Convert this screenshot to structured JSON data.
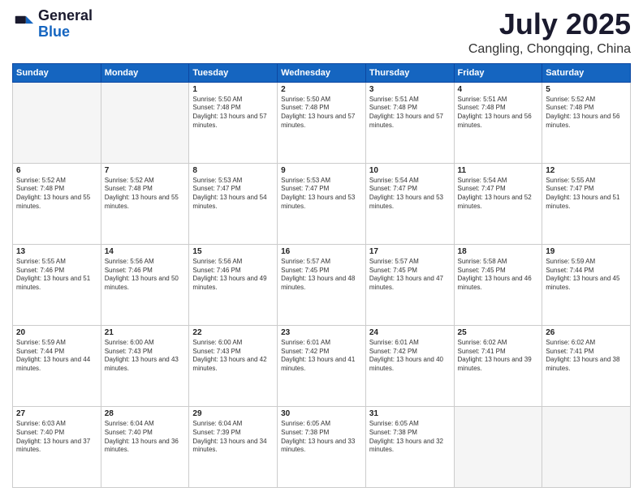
{
  "logo": {
    "line1": "General",
    "line2": "Blue"
  },
  "title": "July 2025",
  "location": "Cangling, Chongqing, China",
  "weekdays": [
    "Sunday",
    "Monday",
    "Tuesday",
    "Wednesday",
    "Thursday",
    "Friday",
    "Saturday"
  ],
  "weeks": [
    [
      {
        "day": "",
        "empty": true
      },
      {
        "day": "",
        "empty": true
      },
      {
        "day": "1",
        "sunrise": "5:50 AM",
        "sunset": "7:48 PM",
        "daylight": "13 hours and 57 minutes."
      },
      {
        "day": "2",
        "sunrise": "5:50 AM",
        "sunset": "7:48 PM",
        "daylight": "13 hours and 57 minutes."
      },
      {
        "day": "3",
        "sunrise": "5:51 AM",
        "sunset": "7:48 PM",
        "daylight": "13 hours and 57 minutes."
      },
      {
        "day": "4",
        "sunrise": "5:51 AM",
        "sunset": "7:48 PM",
        "daylight": "13 hours and 56 minutes."
      },
      {
        "day": "5",
        "sunrise": "5:52 AM",
        "sunset": "7:48 PM",
        "daylight": "13 hours and 56 minutes."
      }
    ],
    [
      {
        "day": "6",
        "sunrise": "5:52 AM",
        "sunset": "7:48 PM",
        "daylight": "13 hours and 55 minutes."
      },
      {
        "day": "7",
        "sunrise": "5:52 AM",
        "sunset": "7:48 PM",
        "daylight": "13 hours and 55 minutes."
      },
      {
        "day": "8",
        "sunrise": "5:53 AM",
        "sunset": "7:47 PM",
        "daylight": "13 hours and 54 minutes."
      },
      {
        "day": "9",
        "sunrise": "5:53 AM",
        "sunset": "7:47 PM",
        "daylight": "13 hours and 53 minutes."
      },
      {
        "day": "10",
        "sunrise": "5:54 AM",
        "sunset": "7:47 PM",
        "daylight": "13 hours and 53 minutes."
      },
      {
        "day": "11",
        "sunrise": "5:54 AM",
        "sunset": "7:47 PM",
        "daylight": "13 hours and 52 minutes."
      },
      {
        "day": "12",
        "sunrise": "5:55 AM",
        "sunset": "7:47 PM",
        "daylight": "13 hours and 51 minutes."
      }
    ],
    [
      {
        "day": "13",
        "sunrise": "5:55 AM",
        "sunset": "7:46 PM",
        "daylight": "13 hours and 51 minutes."
      },
      {
        "day": "14",
        "sunrise": "5:56 AM",
        "sunset": "7:46 PM",
        "daylight": "13 hours and 50 minutes."
      },
      {
        "day": "15",
        "sunrise": "5:56 AM",
        "sunset": "7:46 PM",
        "daylight": "13 hours and 49 minutes."
      },
      {
        "day": "16",
        "sunrise": "5:57 AM",
        "sunset": "7:45 PM",
        "daylight": "13 hours and 48 minutes."
      },
      {
        "day": "17",
        "sunrise": "5:57 AM",
        "sunset": "7:45 PM",
        "daylight": "13 hours and 47 minutes."
      },
      {
        "day": "18",
        "sunrise": "5:58 AM",
        "sunset": "7:45 PM",
        "daylight": "13 hours and 46 minutes."
      },
      {
        "day": "19",
        "sunrise": "5:59 AM",
        "sunset": "7:44 PM",
        "daylight": "13 hours and 45 minutes."
      }
    ],
    [
      {
        "day": "20",
        "sunrise": "5:59 AM",
        "sunset": "7:44 PM",
        "daylight": "13 hours and 44 minutes."
      },
      {
        "day": "21",
        "sunrise": "6:00 AM",
        "sunset": "7:43 PM",
        "daylight": "13 hours and 43 minutes."
      },
      {
        "day": "22",
        "sunrise": "6:00 AM",
        "sunset": "7:43 PM",
        "daylight": "13 hours and 42 minutes."
      },
      {
        "day": "23",
        "sunrise": "6:01 AM",
        "sunset": "7:42 PM",
        "daylight": "13 hours and 41 minutes."
      },
      {
        "day": "24",
        "sunrise": "6:01 AM",
        "sunset": "7:42 PM",
        "daylight": "13 hours and 40 minutes."
      },
      {
        "day": "25",
        "sunrise": "6:02 AM",
        "sunset": "7:41 PM",
        "daylight": "13 hours and 39 minutes."
      },
      {
        "day": "26",
        "sunrise": "6:02 AM",
        "sunset": "7:41 PM",
        "daylight": "13 hours and 38 minutes."
      }
    ],
    [
      {
        "day": "27",
        "sunrise": "6:03 AM",
        "sunset": "7:40 PM",
        "daylight": "13 hours and 37 minutes."
      },
      {
        "day": "28",
        "sunrise": "6:04 AM",
        "sunset": "7:40 PM",
        "daylight": "13 hours and 36 minutes."
      },
      {
        "day": "29",
        "sunrise": "6:04 AM",
        "sunset": "7:39 PM",
        "daylight": "13 hours and 34 minutes."
      },
      {
        "day": "30",
        "sunrise": "6:05 AM",
        "sunset": "7:38 PM",
        "daylight": "13 hours and 33 minutes."
      },
      {
        "day": "31",
        "sunrise": "6:05 AM",
        "sunset": "7:38 PM",
        "daylight": "13 hours and 32 minutes."
      },
      {
        "day": "",
        "empty": true
      },
      {
        "day": "",
        "empty": true
      }
    ]
  ]
}
